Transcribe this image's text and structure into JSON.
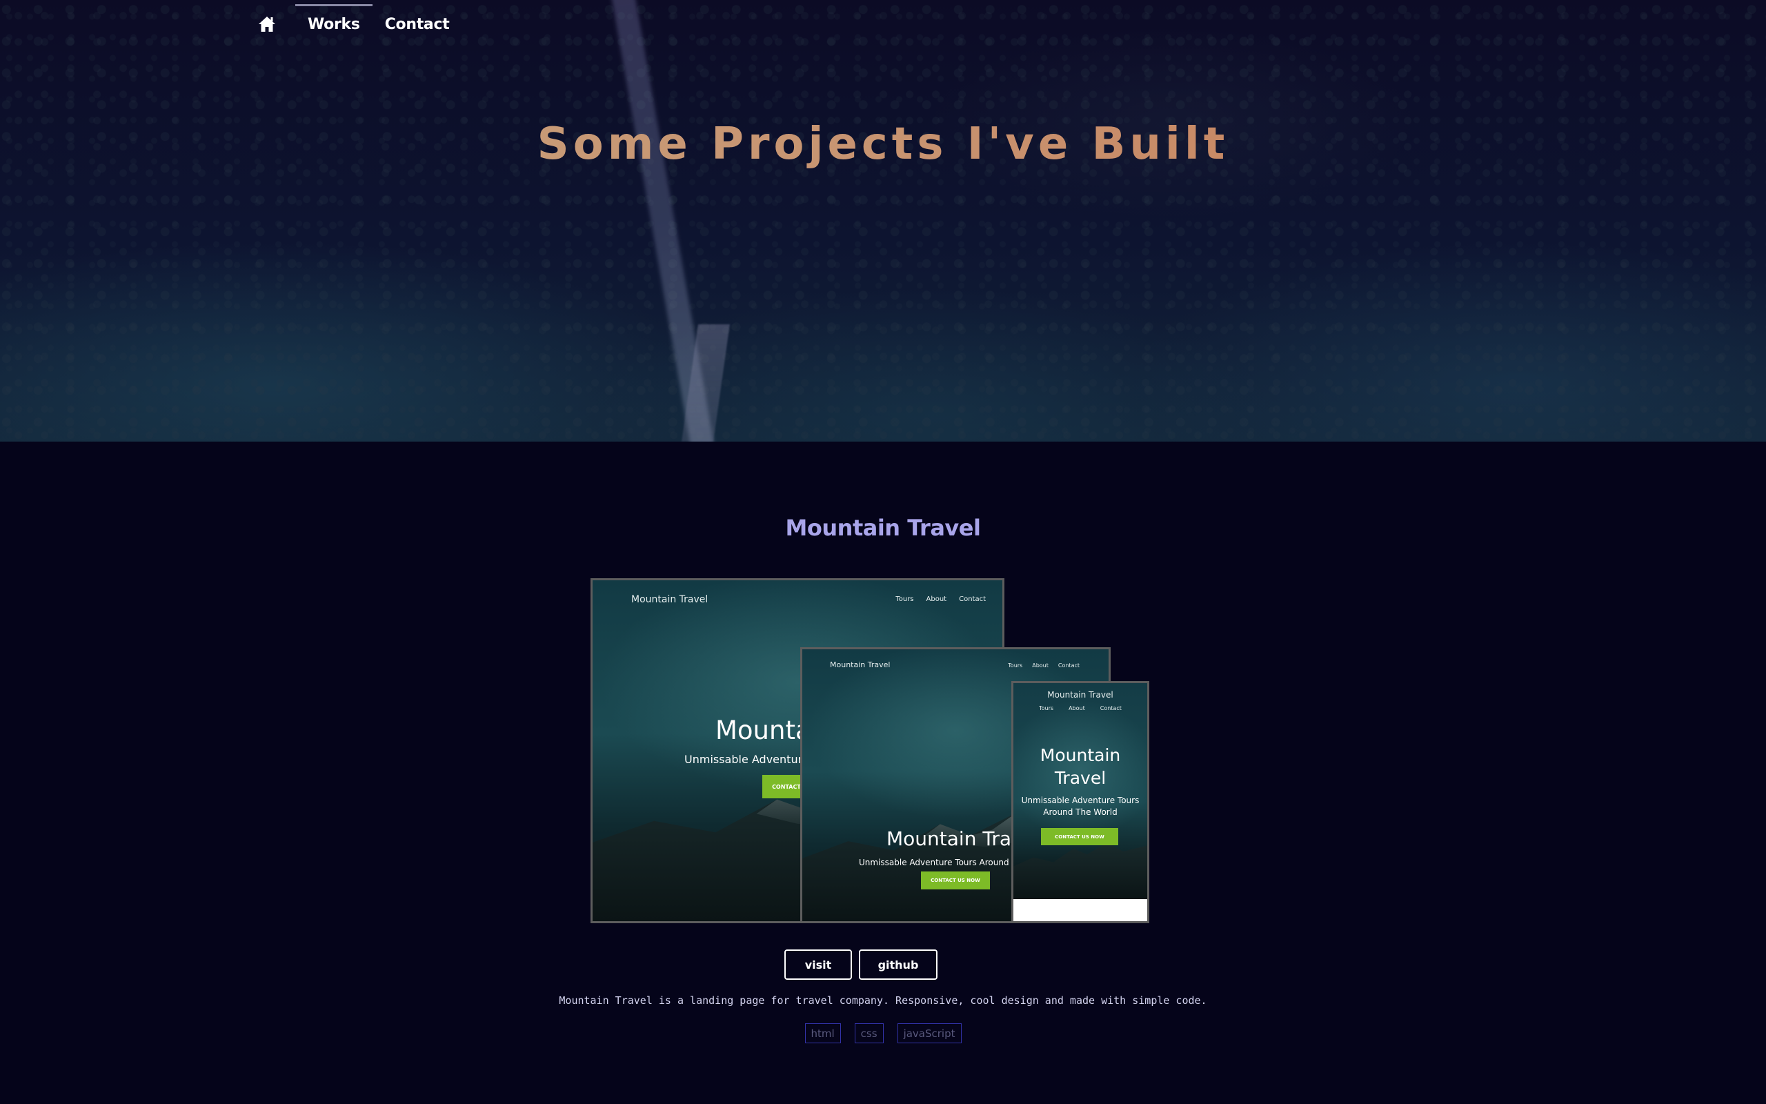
{
  "nav": {
    "home_icon": "home-icon",
    "links": [
      {
        "label": "Works",
        "active": true
      },
      {
        "label": "Contact",
        "active": false
      }
    ]
  },
  "hero": {
    "title": "Some Projects I've Built"
  },
  "project": {
    "title": "Mountain Travel",
    "preview": {
      "brand": "Mountain Travel",
      "links": [
        "Tours",
        "About",
        "Contact"
      ],
      "heading": "Mountain Travel",
      "subheading": "Unmissable Adventure Tours Around The World",
      "cta": "CONTACT US NOW"
    },
    "buttons": {
      "visit": "visit",
      "github": "github"
    },
    "description": "Mountain Travel is a landing page for travel company. Responsive, cool design and made with simple code.",
    "tags": [
      "html",
      "css",
      "javaScript"
    ]
  },
  "colors": {
    "background": "#05041a",
    "title_gradient_start": "#c8a37e",
    "title_gradient_end": "#c97a55",
    "project_title": "#a9a5ea",
    "tag_border": "#3232a8",
    "cta_green": "#7dbb27"
  }
}
